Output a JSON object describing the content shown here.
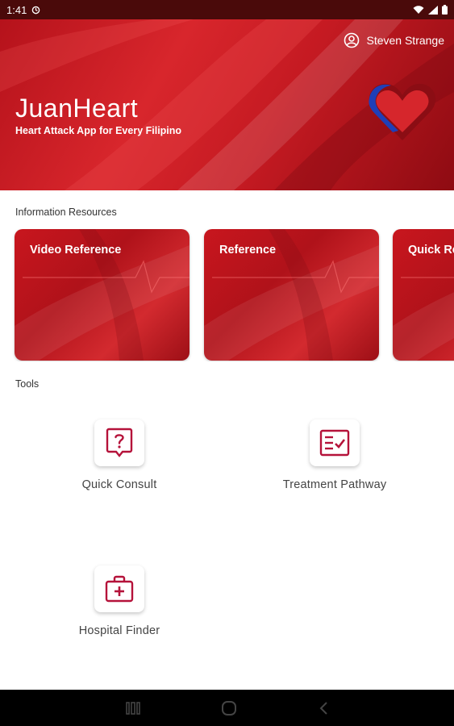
{
  "status_bar": {
    "time": "1:41"
  },
  "header": {
    "user_name": "Steven Strange",
    "app_title": "JuanHeart",
    "app_subtitle": "Heart Attack App for Every Filipino"
  },
  "info_resources": {
    "label": "Information Resources",
    "cards": [
      {
        "title": "Video Reference"
      },
      {
        "title": "Reference"
      },
      {
        "title": "Quick Re"
      }
    ]
  },
  "tools": {
    "label": "Tools",
    "items": [
      {
        "label": "Quick Consult",
        "icon": "question-bubble-icon"
      },
      {
        "label": "Treatment Pathway",
        "icon": "checklist-icon"
      },
      {
        "label": "Hospital Finder",
        "icon": "medical-kit-icon"
      }
    ]
  },
  "colors": {
    "primary": "#c8161e",
    "icon": "#b5123a"
  }
}
